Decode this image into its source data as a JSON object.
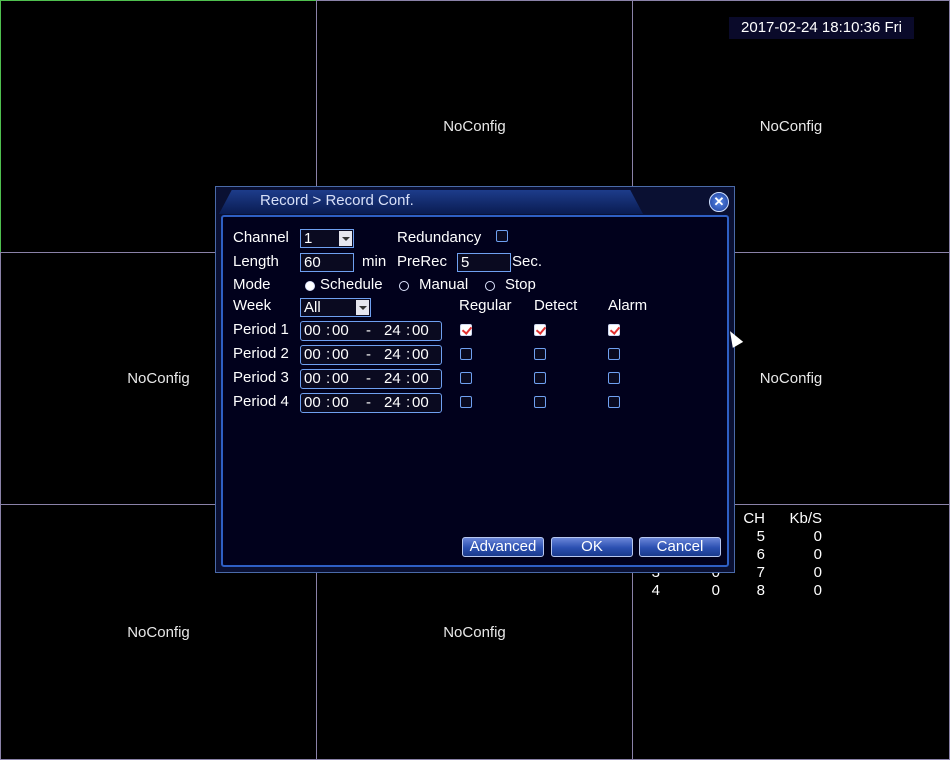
{
  "datetime": "2017-02-24 18:10:36 Fri",
  "cells": [
    "",
    "NoConfig",
    "NoConfig",
    "NoConfig",
    "",
    "NoConfig",
    "NoConfig",
    "NoConfig",
    ""
  ],
  "kbs": {
    "headers": [
      "CH",
      "Kb/S"
    ],
    "rows": [
      [
        "",
        "",
        "5",
        "0"
      ],
      [
        "",
        "",
        "6",
        "0"
      ],
      [
        "3",
        "0",
        "7",
        "0"
      ],
      [
        "4",
        "0",
        "8",
        "0"
      ]
    ]
  },
  "dialog": {
    "title": "Record > Record Conf.",
    "close_glyph": "✕",
    "channel_label": "Channel",
    "channel_value": "1",
    "redundancy_label": "Redundancy",
    "redundancy_checked": false,
    "length_label": "Length",
    "length_value": "60",
    "length_unit": "min",
    "prerec_label": "PreRec",
    "prerec_value": "5",
    "prerec_unit": "Sec.",
    "mode_label": "Mode",
    "modes": [
      {
        "label": "Schedule",
        "selected": true
      },
      {
        "label": "Manual",
        "selected": false
      },
      {
        "label": "Stop",
        "selected": false
      }
    ],
    "week_label": "Week",
    "week_value": "All",
    "col_headers": [
      "Regular",
      "Detect",
      "Alarm"
    ],
    "periods": [
      {
        "label": "Period 1",
        "start_h": "00",
        "start_m": "00",
        "end_h": "24",
        "end_m": "00",
        "regular": true,
        "detect": true,
        "alarm": true
      },
      {
        "label": "Period 2",
        "start_h": "00",
        "start_m": "00",
        "end_h": "24",
        "end_m": "00",
        "regular": false,
        "detect": false,
        "alarm": false
      },
      {
        "label": "Period 3",
        "start_h": "00",
        "start_m": "00",
        "end_h": "24",
        "end_m": "00",
        "regular": false,
        "detect": false,
        "alarm": false
      },
      {
        "label": "Period 4",
        "start_h": "00",
        "start_m": "00",
        "end_h": "24",
        "end_m": "00",
        "regular": false,
        "detect": false,
        "alarm": false
      }
    ],
    "time_sep": ":",
    "range_sep": "-",
    "buttons": {
      "advanced": "Advanced",
      "ok": "OK",
      "cancel": "Cancel"
    }
  }
}
